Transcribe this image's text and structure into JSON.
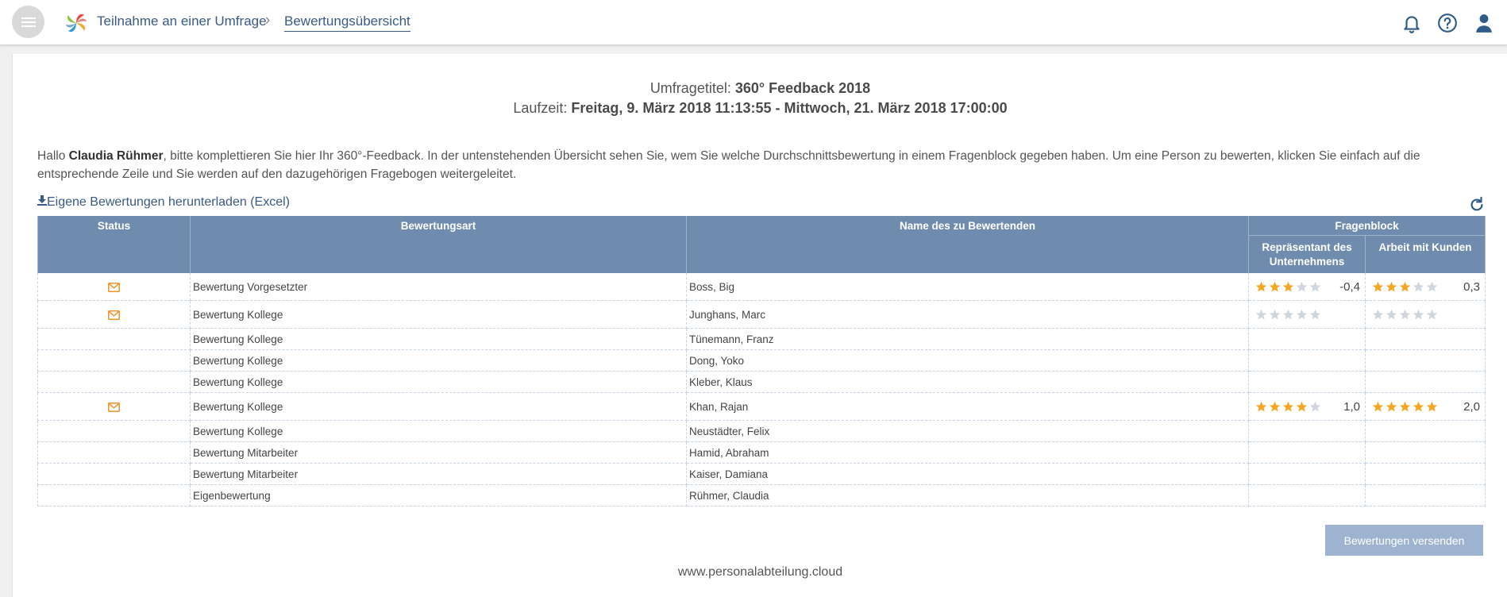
{
  "header": {
    "breadcrumb": [
      "Teilnahme an einer Umfrage",
      "Bewertungsübersicht"
    ]
  },
  "survey": {
    "title_label": "Umfragetitel: ",
    "title_value": "360° Feedback 2018",
    "runtime_label": "Laufzeit: ",
    "runtime_value": "Freitag, 9. März 2018 11:13:55 - Mittwoch, 21. März 2018 17:00:00"
  },
  "intro": {
    "greeting": "Hallo ",
    "user_name": "Claudia Rühmer",
    "text": ", bitte komplettieren Sie hier Ihr 360°-Feedback. In der untenstehenden Übersicht sehen Sie, wem Sie welche Durchschnittsbewertung in einem Fragenblock gegeben haben. Um eine Person zu bewerten, klicken Sie einfach auf die entsprechende Zeile und Sie werden auf den dazugehörigen Fragebogen weitergeleitet."
  },
  "download_link": "Eigene Bewertungen herunterladen (Excel)",
  "table": {
    "headers": {
      "status": "Status",
      "type": "Bewertungsart",
      "name": "Name des zu Bewertenden",
      "block": "Fragenblock",
      "block1": "Repräsentant des Unternehmens",
      "block2": "Arbeit mit Kunden"
    },
    "rows": [
      {
        "mail": true,
        "type": "Bewertung Vorgesetzter",
        "name": "Boss, Big",
        "r1": 3,
        "v1": "-0,4",
        "r2": 3,
        "v2": "0,3"
      },
      {
        "mail": true,
        "type": "Bewertung Kollege",
        "name": "Junghans, Marc",
        "r1": 0,
        "v1": "",
        "r2": 0,
        "v2": ""
      },
      {
        "mail": false,
        "type": "Bewertung Kollege",
        "name": "Tünemann, Franz",
        "r1": null,
        "v1": "",
        "r2": null,
        "v2": ""
      },
      {
        "mail": false,
        "type": "Bewertung Kollege",
        "name": "Dong, Yoko",
        "r1": null,
        "v1": "",
        "r2": null,
        "v2": ""
      },
      {
        "mail": false,
        "type": "Bewertung Kollege",
        "name": "Kleber, Klaus",
        "r1": null,
        "v1": "",
        "r2": null,
        "v2": ""
      },
      {
        "mail": true,
        "type": "Bewertung Kollege",
        "name": "Khan, Rajan",
        "r1": 4,
        "v1": "1,0",
        "r2": 5,
        "v2": "2,0"
      },
      {
        "mail": false,
        "type": "Bewertung Kollege",
        "name": "Neustädter, Felix",
        "r1": null,
        "v1": "",
        "r2": null,
        "v2": ""
      },
      {
        "mail": false,
        "type": "Bewertung Mitarbeiter",
        "name": "Hamid, Abraham",
        "r1": null,
        "v1": "",
        "r2": null,
        "v2": ""
      },
      {
        "mail": false,
        "type": "Bewertung Mitarbeiter",
        "name": "Kaiser, Damiana",
        "r1": null,
        "v1": "",
        "r2": null,
        "v2": ""
      },
      {
        "mail": false,
        "type": "Eigenbewertung",
        "name": "Rühmer, Claudia",
        "r1": null,
        "v1": "",
        "r2": null,
        "v2": ""
      }
    ]
  },
  "send_button": "Bewertungen versenden",
  "footer": "www.personalabteilung.cloud",
  "colors": {
    "accent": "#3a5a86",
    "header_bg": "#6f8caf",
    "star_filled": "#f5a623",
    "star_empty": "#cfd6dd",
    "mail": "#f0922b"
  }
}
